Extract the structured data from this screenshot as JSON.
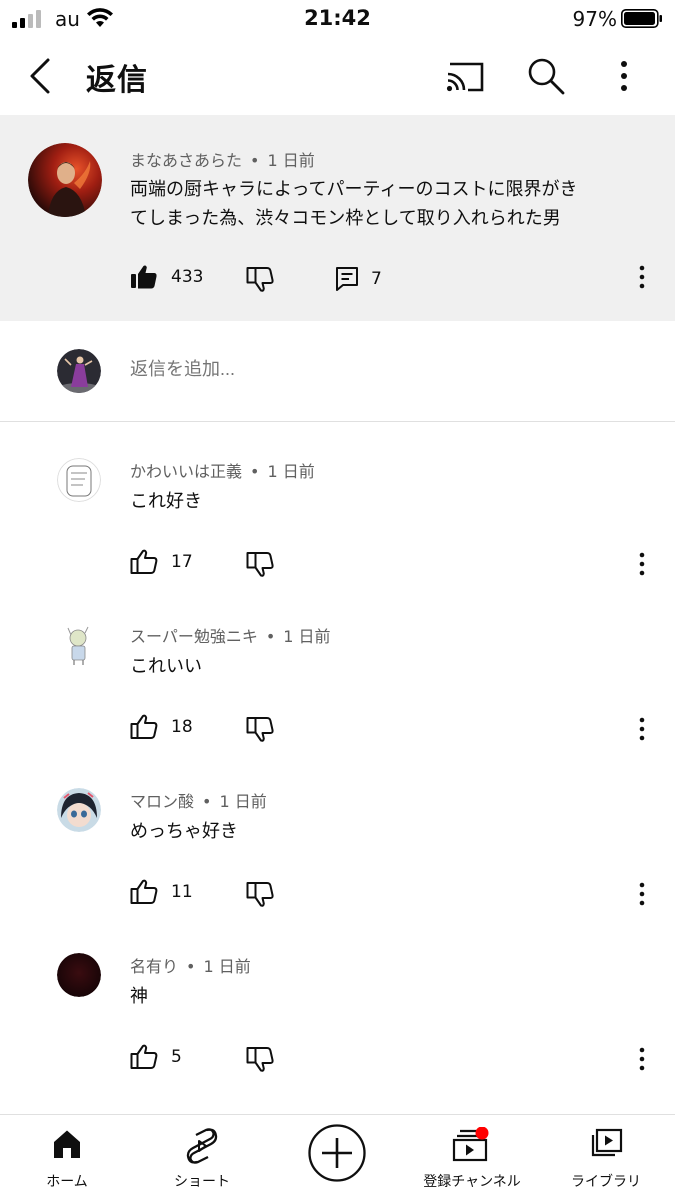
{
  "status_bar": {
    "carrier": "au",
    "time": "21:42",
    "battery_percent": "97%",
    "battery_level": 0.97
  },
  "header": {
    "title": "返信",
    "icons": [
      "back-icon",
      "cast-icon",
      "search-icon",
      "more-vertical-icon"
    ]
  },
  "parent_comment": {
    "author": "まなあさあらた",
    "time": "1 日前",
    "text_line1": "両端の厨キャラによってパーティーのコストに限界がき",
    "text_line2": "てしまった為、渋々コモン枠として取り入れられた男",
    "likes": "433",
    "replies": "7",
    "liked": true
  },
  "add_reply": {
    "placeholder": "返信を追加..."
  },
  "replies": [
    {
      "author": "かわいいは正義",
      "time": "1 日前",
      "text": "これ好き",
      "likes": "17"
    },
    {
      "author": "スーパー勉強ニキ",
      "time": "1 日前",
      "text": "これいい",
      "likes": "18"
    },
    {
      "author": "マロン酸",
      "time": "1 日前",
      "text": "めっちゃ好き",
      "likes": "11"
    },
    {
      "author": "名有り",
      "time": "1 日前",
      "text": "神",
      "likes": "5"
    }
  ],
  "bottom_nav": {
    "home": "ホーム",
    "shorts": "ショート",
    "subscriptions": "登録チャンネル",
    "library": "ライブラリ"
  },
  "colors": {
    "parent_background": "#f0f0f0",
    "meta_text": "#606060",
    "notification_dot": "#ff0000"
  }
}
